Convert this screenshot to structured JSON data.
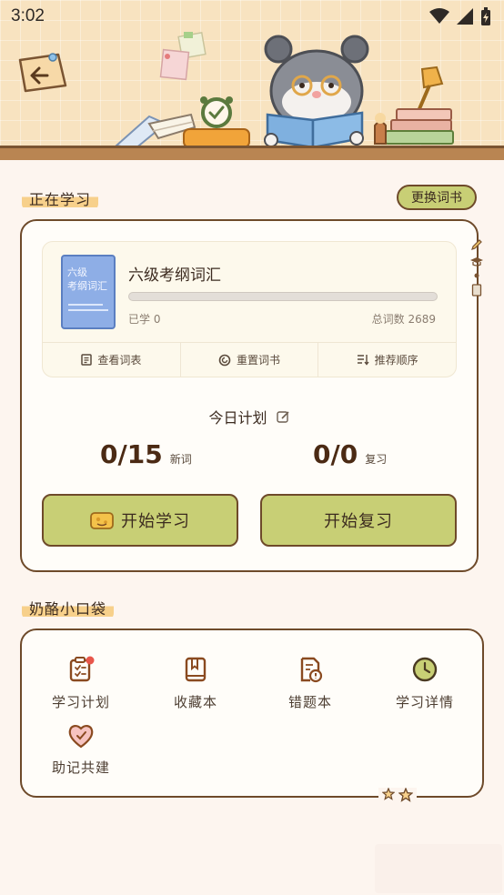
{
  "status_bar": {
    "time": "3:02"
  },
  "current_study": {
    "section_label": "正在学习",
    "change_book_label": "更换词书",
    "book": {
      "cover_line1": "六级",
      "cover_line2": "考纲词汇",
      "title": "六级考纲词汇",
      "progress": 0,
      "learned_label": "已学 0",
      "total_label": "总词数 2689"
    },
    "actions": [
      {
        "label": "查看词表",
        "icon": "list-doc-icon"
      },
      {
        "label": "重置词书",
        "icon": "reset-icon"
      },
      {
        "label": "推荐顺序",
        "icon": "sort-icon"
      }
    ],
    "plan_title": "今日计划",
    "new_words": {
      "value": "0/15",
      "label": "新词"
    },
    "review": {
      "value": "0/0",
      "label": "复习"
    },
    "start_learning_label": "开始学习",
    "start_review_label": "开始复习"
  },
  "pocket": {
    "section_label": "奶酪小口袋",
    "tools": [
      {
        "label": "学习计划",
        "icon": "clipboard-icon",
        "badge": true
      },
      {
        "label": "收藏本",
        "icon": "bookmark-book-icon"
      },
      {
        "label": "错题本",
        "icon": "error-doc-icon"
      },
      {
        "label": "学习详情",
        "icon": "clock-icon"
      },
      {
        "label": "助记共建",
        "icon": "heart-icon"
      }
    ]
  },
  "colors": {
    "accent_green": "#c8cf75",
    "border_brown": "#6e4a2a",
    "highlight_yellow": "#f7d08b",
    "badge_red": "#e8564b",
    "background": "#fdf5ef"
  }
}
